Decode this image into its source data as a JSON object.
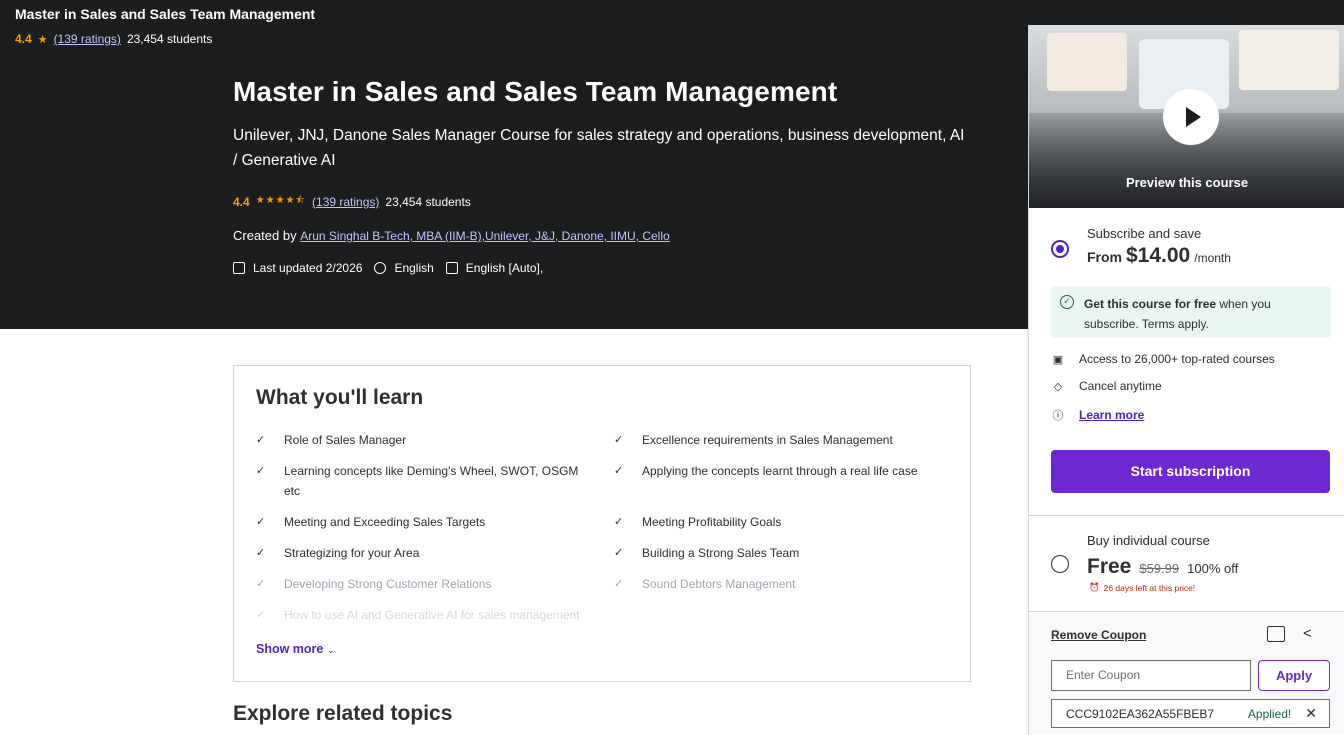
{
  "sticky": {
    "title": "Master in Sales and Sales Team Management",
    "rating": "4.4",
    "ratings_link": "(139 ratings)",
    "students": "23,454 students"
  },
  "hero": {
    "title": "Master in Sales and Sales Team Management",
    "subtitle": "Unilever, JNJ, Danone Sales Manager Course for sales strategy and operations, business development, AI / Generative AI",
    "rating": "4.4",
    "stars": "★★★★⯪",
    "ratings_link": "(139 ratings)",
    "students": "23,454 students",
    "created_by_label": "Created by",
    "instructor": "Arun Singhal B-Tech, MBA (IIM-B),Unilever, J&J, Danone, IIMU, Cello",
    "last_updated": "Last updated 2/2026",
    "language": "English",
    "captions": "English [Auto],"
  },
  "learn": {
    "heading": "What you'll learn",
    "left_items": [
      "Role of Sales Manager",
      "Learning concepts like Deming's Wheel, SWOT, OSGM etc",
      "Meeting and Exceeding Sales Targets",
      "Strategizing for your Area",
      "Developing Strong Customer Relations",
      "How to use AI and Generative AI for sales management"
    ],
    "right_items": [
      "Excellence requirements in Sales Management",
      "Applying the concepts learnt through a real life case",
      "Meeting Profitability Goals",
      "Building a Strong Sales Team",
      "Sound Debtors Management"
    ],
    "show_more": "Show more"
  },
  "explore_heading": "Explore related topics",
  "sidebar": {
    "preview_label": "Preview this course",
    "subscribe": {
      "title": "Subscribe and save",
      "from": "From",
      "price": "$14.00",
      "per": "/month",
      "free_bold": "Get this course for free",
      "free_rest": " when you subscribe. Terms apply.",
      "features": [
        "Access to 26,000+ top-rated courses",
        "Cancel anytime",
        "Learn more"
      ],
      "button": "Start subscription"
    },
    "buy": {
      "title": "Buy individual course",
      "price": "Free",
      "original": "$59.99",
      "discount": "100% off",
      "days_left": "26 days left at this price!"
    },
    "coupon": {
      "remove": "Remove Coupon",
      "placeholder": "Enter Coupon",
      "apply": "Apply",
      "code": "CCC9102EA362A55FBEB7",
      "applied": "Applied!"
    }
  }
}
